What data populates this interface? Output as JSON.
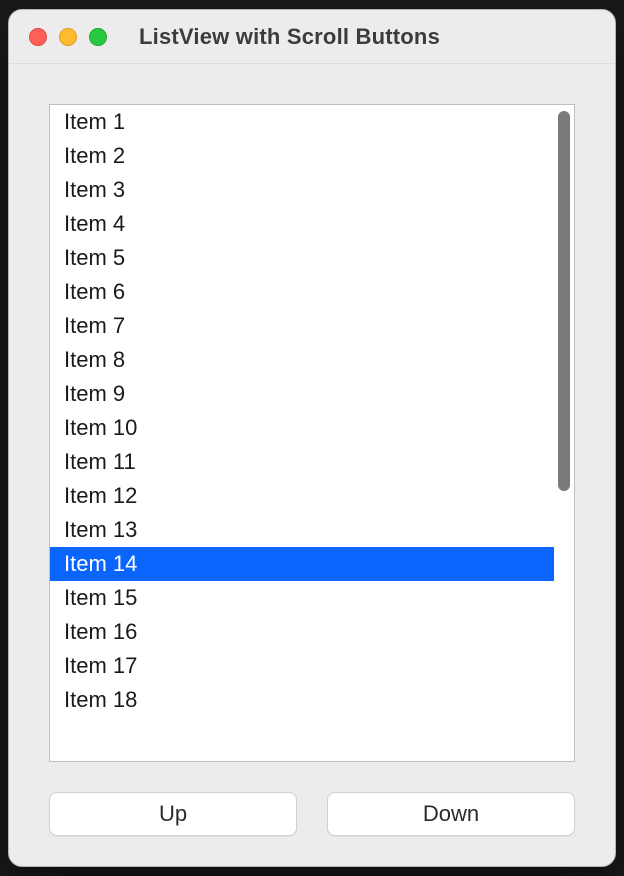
{
  "window": {
    "title": "ListView with Scroll Buttons"
  },
  "list": {
    "items": [
      "Item 1",
      "Item 2",
      "Item 3",
      "Item 4",
      "Item 5",
      "Item 6",
      "Item 7",
      "Item 8",
      "Item 9",
      "Item 10",
      "Item 11",
      "Item 12",
      "Item 13",
      "Item 14",
      "Item 15",
      "Item 16",
      "Item 17",
      "Item 18"
    ],
    "selected_index": 13
  },
  "buttons": {
    "up": "Up",
    "down": "Down"
  },
  "colors": {
    "selection": "#0a65ff",
    "window_bg": "#ececec"
  }
}
